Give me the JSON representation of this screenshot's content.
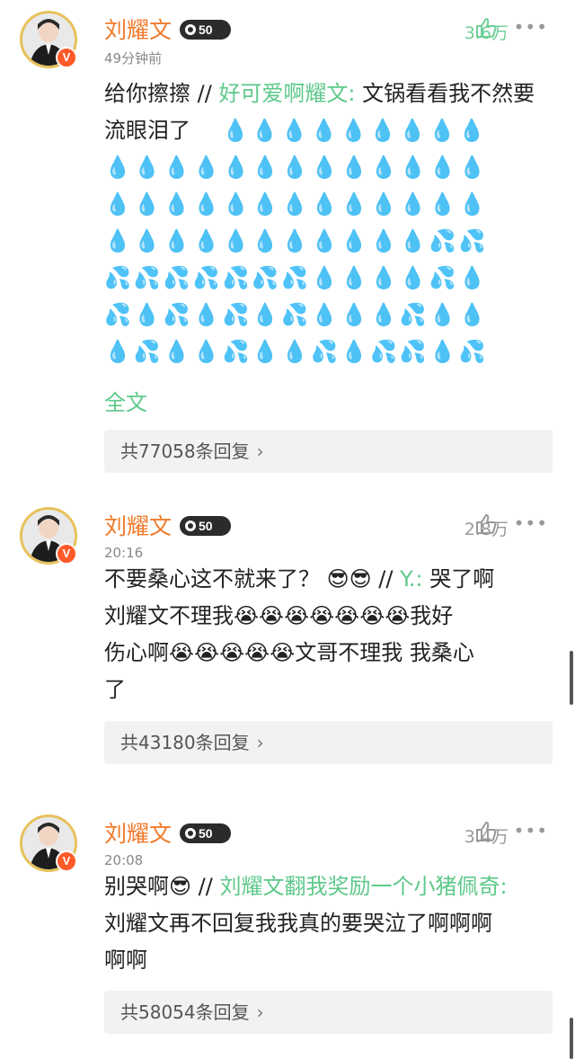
{
  "comments": [
    {
      "username": "刘耀文",
      "level": "50",
      "time": "49分钟前",
      "likes": "3.6万",
      "reply_prefix": "给你擦擦 // ",
      "quoted_user": "好可爱啊耀文:",
      "body_text": " 文锅看看我不然要流眼泪了",
      "emoji_rows": [
        "💧💧💧💧💧💧💧💧💧",
        "💧💧💧💧💧💧💧💧💧💧💧💧💧",
        "💧💧💧💧💧💧💧💧💧💧💧💧💧",
        "💧💧💧💧💧💧💧💧💧💧💧💦💦",
        "💦💦💦💦💦💦💦💧💧💧💧💦💧",
        "💦💧💦💧💦💧💦💧💧💧💦💧💧",
        "💧💦💧💧💦💧💧💦💧💦💦💧💦"
      ],
      "full_text_label": "全文",
      "replies_label": "共77058条回复"
    },
    {
      "username": "刘耀文",
      "level": "50",
      "time": "20:16",
      "likes": "2.8万",
      "line1": "不要桑心这不就来了？ 😎😎 // ",
      "quoted_user": "Y.:",
      "line1_rest": " 哭了啊",
      "line2": "刘耀文不理我😭😭😭😭😭😭😭我好",
      "line3": "伤心啊😭😭😭😭😭文哥不理我 我桑心",
      "line4": "了",
      "replies_label": "共43180条回复"
    },
    {
      "username": "刘耀文",
      "level": "50",
      "time": "20:08",
      "likes": "3.4万",
      "line1": "别哭啊😎 // ",
      "quoted_user": "刘耀文翻我奖励一个小猪佩奇:",
      "line2": "刘耀文再不回复我我真的要哭泣了啊啊啊",
      "line3": "啊啊",
      "replies_label": "共58054条回复"
    }
  ],
  "icons": {
    "thumb": "thumbs-up-icon",
    "more": "more-dots-icon",
    "verified": "verified-v-badge"
  },
  "colors": {
    "username": "#f07a2b",
    "link": "#5ec98a",
    "badge": "#ff5a2a"
  }
}
